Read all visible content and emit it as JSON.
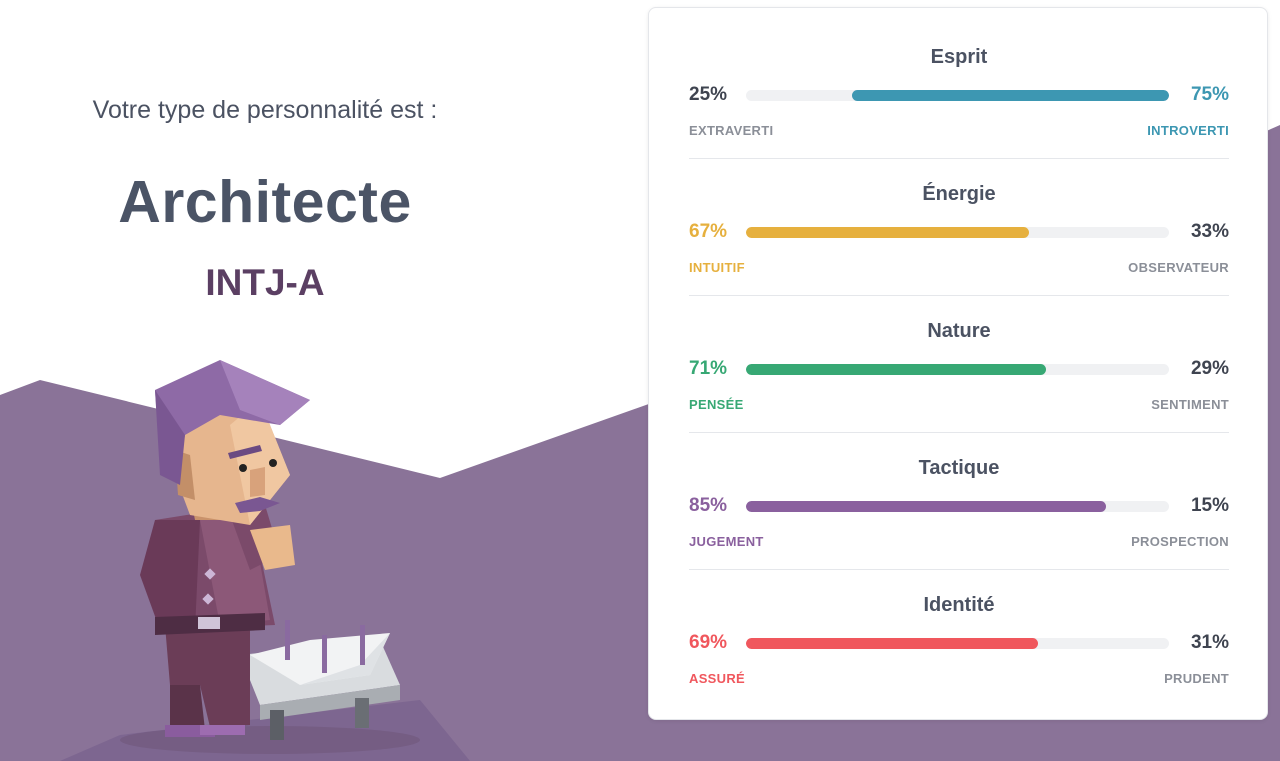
{
  "header": {
    "intro": "Votre type de personnalité est :",
    "type_name": "Architecte",
    "type_code": "INTJ-A"
  },
  "colors": {
    "background_shape": "#8a7398",
    "title_text": "#4b5466",
    "code_text": "#5b3f63",
    "muted_text": "#8b8f98",
    "track": "#f0f1f3"
  },
  "illustration": {
    "icon": "architect-character-illustration"
  },
  "traits": [
    {
      "title": "Esprit",
      "left_percent": "25%",
      "right_percent": "75%",
      "left_label": "EXTRAVERTI",
      "right_label": "INTROVERTI",
      "dominant": "right",
      "value": 75,
      "color": "#3d97b2"
    },
    {
      "title": "Énergie",
      "left_percent": "67%",
      "right_percent": "33%",
      "left_label": "INTUITIF",
      "right_label": "OBSERVATEUR",
      "dominant": "left",
      "value": 67,
      "color": "#e6b03e"
    },
    {
      "title": "Nature",
      "left_percent": "71%",
      "right_percent": "29%",
      "left_label": "PENSÉE",
      "right_label": "SENTIMENT",
      "dominant": "left",
      "value": 71,
      "color": "#37a874"
    },
    {
      "title": "Tactique",
      "left_percent": "85%",
      "right_percent": "15%",
      "left_label": "JUGEMENT",
      "right_label": "PROSPECTION",
      "dominant": "left",
      "value": 85,
      "color": "#8a609e"
    },
    {
      "title": "Identité",
      "left_percent": "69%",
      "right_percent": "31%",
      "left_label": "ASSURÉ",
      "right_label": "PRUDENT",
      "dominant": "left",
      "value": 69,
      "color": "#f0575d"
    }
  ]
}
